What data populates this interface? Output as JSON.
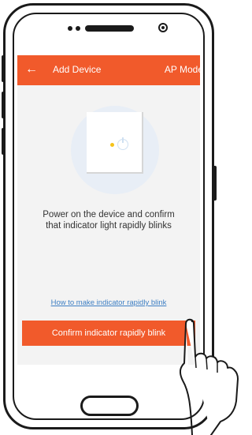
{
  "appbar": {
    "back_icon": "←",
    "title": "Add Device",
    "mode": "AP Mode"
  },
  "content": {
    "instruction_line1": "Power on the device and confirm",
    "instruction_line2": "that indicator light rapidly blinks",
    "help_link": "How to make indicator rapidly blink",
    "confirm_button": "Confirm indicator rapidly blink"
  },
  "colors": {
    "accent": "#f15a2b",
    "link": "#3d7fc4",
    "screen_bg": "#f3f3f3",
    "indicator_light": "#f5c31a"
  },
  "icons": [
    "back-arrow-icon",
    "indicator-light-icon",
    "power-icon",
    "pointing-hand-icon"
  ]
}
